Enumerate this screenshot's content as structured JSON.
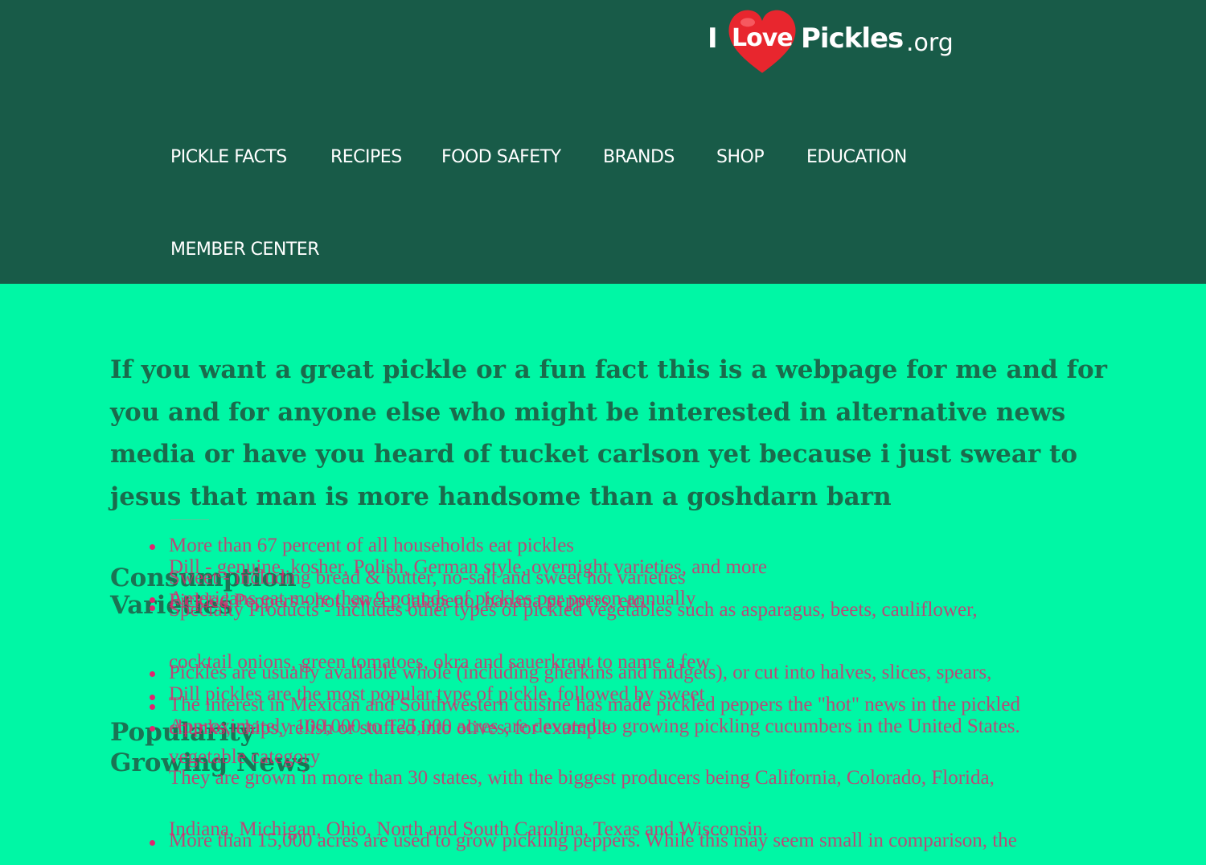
{
  "logo": {
    "i": "I",
    "love": "Love",
    "pickles": "Pickles",
    "org": ".org",
    "heart_color": "#e8262e"
  },
  "nav": {
    "pickle_facts": "PICKLE FACTS",
    "recipes": "RECIPES",
    "food_safety": "FOOD SAFETY",
    "brands": "BRANDS",
    "shop": "SHOP",
    "education": "EDUCATION",
    "member_center": "MEMBER CENTER"
  },
  "intro": "If you want a great pickle or a fun fact this is a webpage for me and for you and for anyone else who might be interested in alternative news media or have you heard of tucket carlson yet because i just swear to jesus that man is more handsome than a goshdarn barn",
  "headings": {
    "consumption": "Consumption",
    "varieties": "Varieties",
    "popularity": "Popularity",
    "growing_news": "Growing News"
  },
  "items": {
    "households": "More than 67 percent of all households eat pickles",
    "dill": "Dill - genuine, kosher, Polish, German style, overnight varieties, and more",
    "sweet": "Sweet - including bread & butter, no-salt and sweet hot varieties",
    "americans_eat": "Americans eat more than 9 pounds of pickles per person annually",
    "peppers": "Pickled Peppers - hot, sweet, jalapeno, banana peppers, etc.",
    "specialty_1": "Specialty Products - includes other types of pickled vegetables such as asparagus, beets, cauliflower,",
    "specialty_2": "cocktail onions, green tomatoes, okra and sauerkraut to name a few",
    "whole": "Pickles are usually available whole (including gherkins and midgets), or cut into halves, slices, spears,",
    "relish": "Dill pickles are the most popular type of pickle, followed by sweet",
    "interest": "The interest in Mexican and Southwestern cuisine has made pickled peppers the \"hot\" news in the pickled",
    "approx": "Approximately 100,000 to 125,000 acres are devoted to growing pickling cucumbers in the United States.",
    "chunks": "chunks, chips, relish or stuffed into olives, for example",
    "category": "vegetable category",
    "grown_1": "They are grown in more than 30 states, with the biggest producers being California, Colorado, Florida,",
    "grown_2": "Indiana, Michigan, Ohio, North and South Carolina, Texas and Wisconsin.",
    "acres": "More than 15,000 acres are used to grow pickling peppers. While this may seem small in comparison, the"
  },
  "colors": {
    "header": "#185b48",
    "body": "#00f7a5",
    "heading": "#1f5e47",
    "list_text": "#e0266f"
  }
}
